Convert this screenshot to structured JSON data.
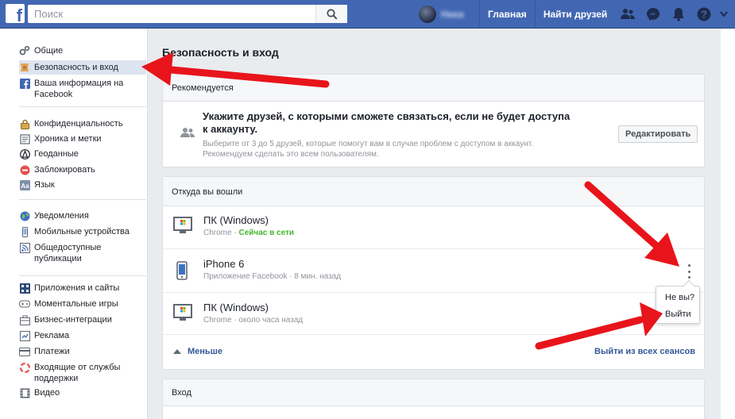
{
  "header": {
    "search_placeholder": "Поиск",
    "user_name": "Ника",
    "home_label": "Главная",
    "find_friends_label": "Найти друзей"
  },
  "sidebar": {
    "groups": [
      [
        {
          "label": "Общие",
          "icon": "gears-icon"
        },
        {
          "label": "Безопасность и вход",
          "icon": "badge-icon",
          "active": true
        },
        {
          "label": "Ваша информация на Facebook",
          "icon": "facebook-icon"
        }
      ],
      [
        {
          "label": "Конфиденциальность",
          "icon": "lock-icon"
        },
        {
          "label": "Хроника и метки",
          "icon": "timeline-icon"
        },
        {
          "label": "Геоданные",
          "icon": "location-icon"
        },
        {
          "label": "Заблокировать",
          "icon": "block-icon"
        },
        {
          "label": "Язык",
          "icon": "language-icon"
        }
      ],
      [
        {
          "label": "Уведомления",
          "icon": "globe-icon"
        },
        {
          "label": "Мобильные устройства",
          "icon": "mobile-icon"
        },
        {
          "label": "Общедоступные публикации",
          "icon": "rss-icon"
        }
      ],
      [
        {
          "label": "Приложения и сайты",
          "icon": "apps-icon"
        },
        {
          "label": "Моментальные игры",
          "icon": "gamepad-icon"
        },
        {
          "label": "Бизнес-интеграции",
          "icon": "business-icon"
        },
        {
          "label": "Реклама",
          "icon": "ads-icon"
        },
        {
          "label": "Платежи",
          "icon": "card-icon"
        },
        {
          "label": "Входящие от службы поддержки",
          "icon": "lifebuoy-icon"
        },
        {
          "label": "Видео",
          "icon": "film-icon"
        }
      ]
    ]
  },
  "main": {
    "title": "Безопасность и вход",
    "recommended": {
      "header": "Рекомендуется",
      "title": "Укажите друзей, с которыми сможете связаться, если не будет доступа к аккаунту.",
      "description": "Выберите от 3 до 5 друзей, которые помогут вам в случае проблем с доступом в аккаунт. Рекомендуем сделать это всем пользователям.",
      "edit_label": "Редактировать"
    },
    "sessions": {
      "header": "Откуда вы вошли",
      "items": [
        {
          "device": "ПК (Windows)",
          "client": "Chrome",
          "status": "Сейчас в сети",
          "online": true,
          "icon": "desktop-icon"
        },
        {
          "device": "iPhone 6",
          "client": "Приложение Facebook",
          "status": "8 мин. назад",
          "online": false,
          "icon": "phone-icon"
        },
        {
          "device": "ПК (Windows)",
          "client": "Chrome",
          "status": "около часа назад",
          "online": false,
          "icon": "desktop-icon"
        }
      ],
      "less_label": "Меньше",
      "logout_all_label": "Выйти из всех сеансов",
      "menu": {
        "not_you": "Не вы?",
        "logout": "Выйти"
      }
    },
    "login": {
      "header": "Вход"
    }
  },
  "colors": {
    "brand": "#4267b2",
    "annotation_arrow": "#e8141b",
    "online": "#42b72a"
  }
}
